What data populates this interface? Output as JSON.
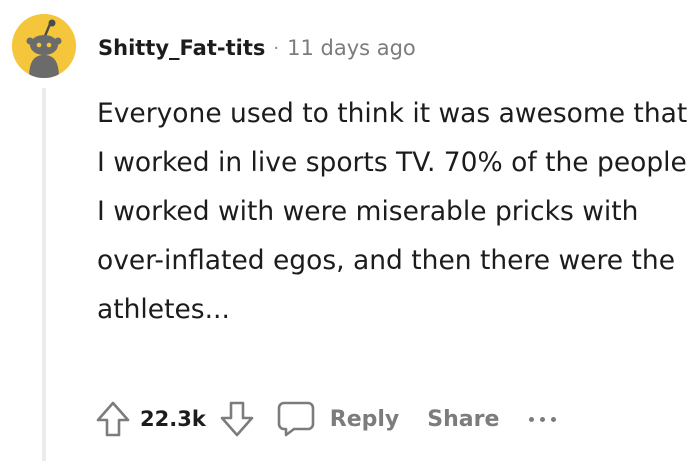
{
  "comment": {
    "username": "Shitty_Fat-tits",
    "separator": "·",
    "timestamp": "11 days ago",
    "avatar_icon": "snoo-avatar-icon",
    "avatar_color": "#f5c53c",
    "body": "Everyone used to think it was awesome that I worked in live sports TV. 70% of the people I worked with were miserable pricks with over-inflated egos, and then there were the athletes..."
  },
  "actions": {
    "upvote_icon": "upvote-arrow-icon",
    "score": "22.3k",
    "downvote_icon": "downvote-arrow-icon",
    "reply_icon": "speech-bubble-icon",
    "reply_label": "Reply",
    "share_label": "Share",
    "more_icon": "ellipsis-icon"
  },
  "colors": {
    "text": "#1c1c1c",
    "muted": "#7c7c7c",
    "thread_line": "#ececec"
  }
}
